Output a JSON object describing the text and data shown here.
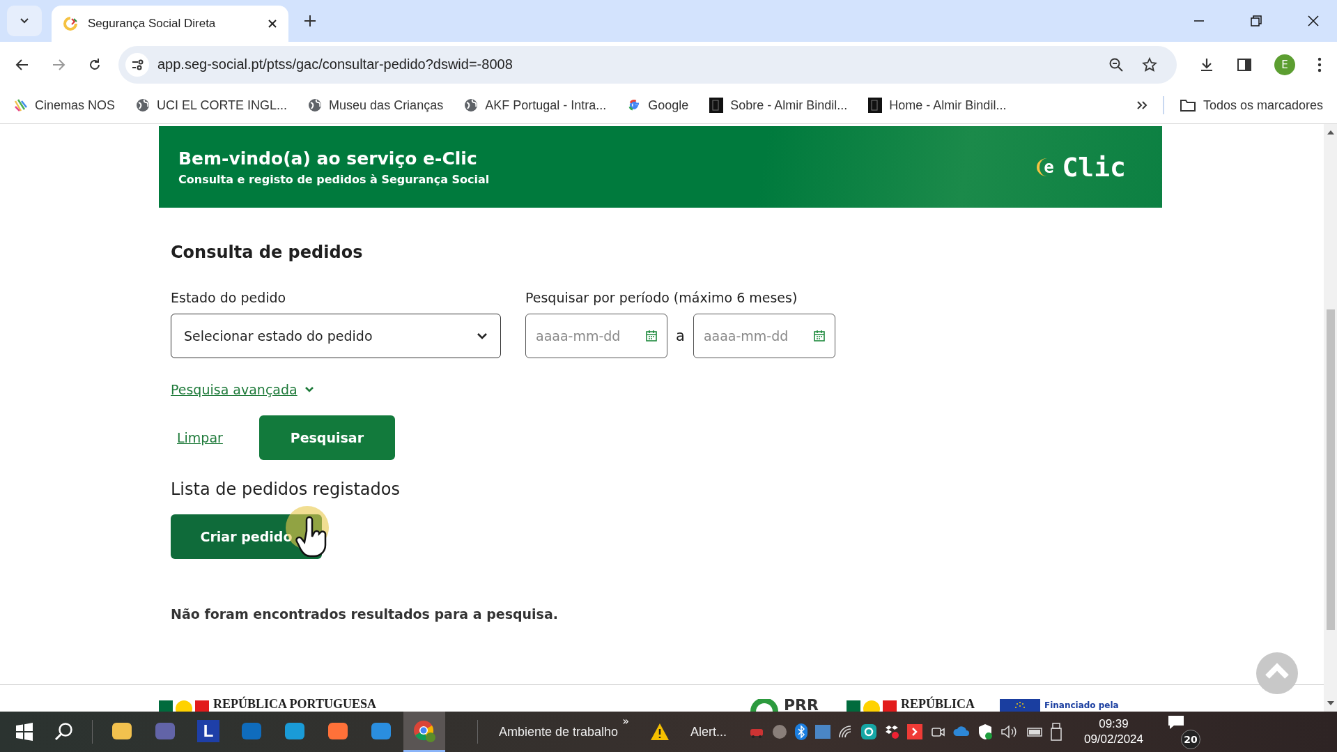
{
  "browser": {
    "tabs": [
      {
        "title": "Segurança Social Direta",
        "selected": true
      }
    ],
    "url": "app.seg-social.pt/ptss/gac/consultar-pedido?dswid=-8008",
    "profile": "E",
    "bookmarks": [
      {
        "label": "Cinemas NOS",
        "kind": "stripes"
      },
      {
        "label": "UCI EL CORTE INGL...",
        "kind": "globe"
      },
      {
        "label": "Museu das Crianças",
        "kind": "globe"
      },
      {
        "label": "AKF Portugal - Intra...",
        "kind": "globe"
      },
      {
        "label": "Google",
        "kind": "google"
      },
      {
        "label": "Sobre - Almir Bindil...",
        "kind": "thumb"
      },
      {
        "label": "Home - Almir Bindil...",
        "kind": "thumb"
      }
    ],
    "all_bookmarks": "Todos os marcadores"
  },
  "banner": {
    "title": "Bem-vindo(a) ao serviço e-Clic",
    "subtitle": "Consulta e registo de pedidos à Segurança Social",
    "logo_mark": "e",
    "logo_text": "Clic"
  },
  "search": {
    "heading": "Consulta de pedidos",
    "status_label": "Estado do pedido",
    "status_placeholder": "Selecionar estado do pedido",
    "period_label": "Pesquisar por período (máximo 6 meses)",
    "date_from_placeholder": "aaaa-mm-dd",
    "date_separator": "a",
    "date_to_placeholder": "aaaa-mm-dd",
    "advanced_link": "Pesquisa avançada",
    "clear_link": "Limpar",
    "search_button": "Pesquisar"
  },
  "list": {
    "heading": "Lista de pedidos registados",
    "create_button": "Criar pedido",
    "empty_message": "Não foram encontrados resultados para a pesquisa."
  },
  "footer": {
    "logos": [
      {
        "kind": "flag",
        "text": "REPÚBLICA PORTUGUESA"
      },
      {
        "kind": "prr",
        "text": "PRR"
      },
      {
        "kind": "flag",
        "text": "REPÚBLICA"
      },
      {
        "kind": "eu",
        "text": "Financiado pela"
      }
    ]
  },
  "taskbar": {
    "apps": [
      {
        "kind": "files",
        "selected": false
      },
      {
        "kind": "teams",
        "selected": false
      },
      {
        "kind": "letter",
        "selected": false
      },
      {
        "kind": "outlook",
        "selected": false
      },
      {
        "kind": "edge",
        "selected": false
      },
      {
        "kind": "firefox",
        "selected": false
      },
      {
        "kind": "mail",
        "selected": false
      },
      {
        "kind": "chrome",
        "selected": true
      }
    ],
    "app_letter": "L",
    "desktop_label": "Ambiente de trabalho",
    "more": "»",
    "alert": "Alert...",
    "time": "09:39",
    "date": "09/02/2024",
    "notifications": "20"
  }
}
